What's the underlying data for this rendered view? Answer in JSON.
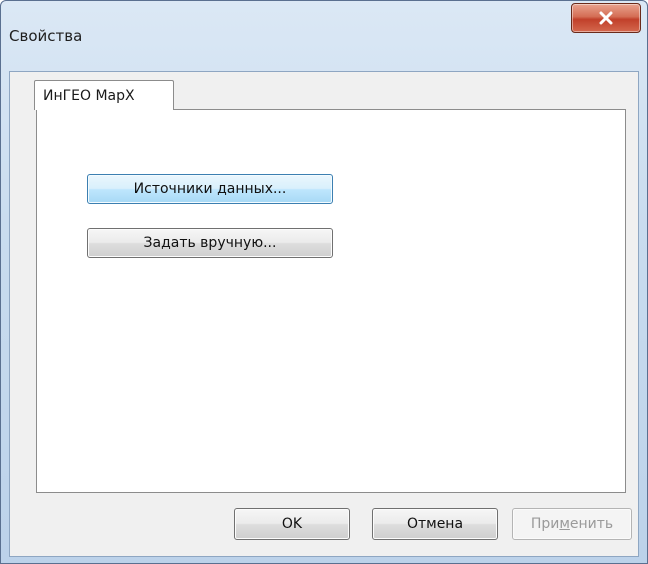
{
  "window": {
    "title": "Свойства",
    "close_icon": "close-x-icon"
  },
  "tabs": [
    {
      "label": "ИнГЕО MapX",
      "selected": true
    }
  ],
  "panel": {
    "data_sources_label": "Источники данных...",
    "manual_label": "Задать вручную..."
  },
  "footer": {
    "ok_label": "OK",
    "cancel_label": "Отмена",
    "apply_label_before": "При",
    "apply_label_mnemonic": "м",
    "apply_label_after": "енить",
    "apply_enabled": false
  },
  "colors": {
    "close_button": "#c7472f",
    "hot_button": "#bee6fd",
    "frame": "#c9dcef"
  }
}
